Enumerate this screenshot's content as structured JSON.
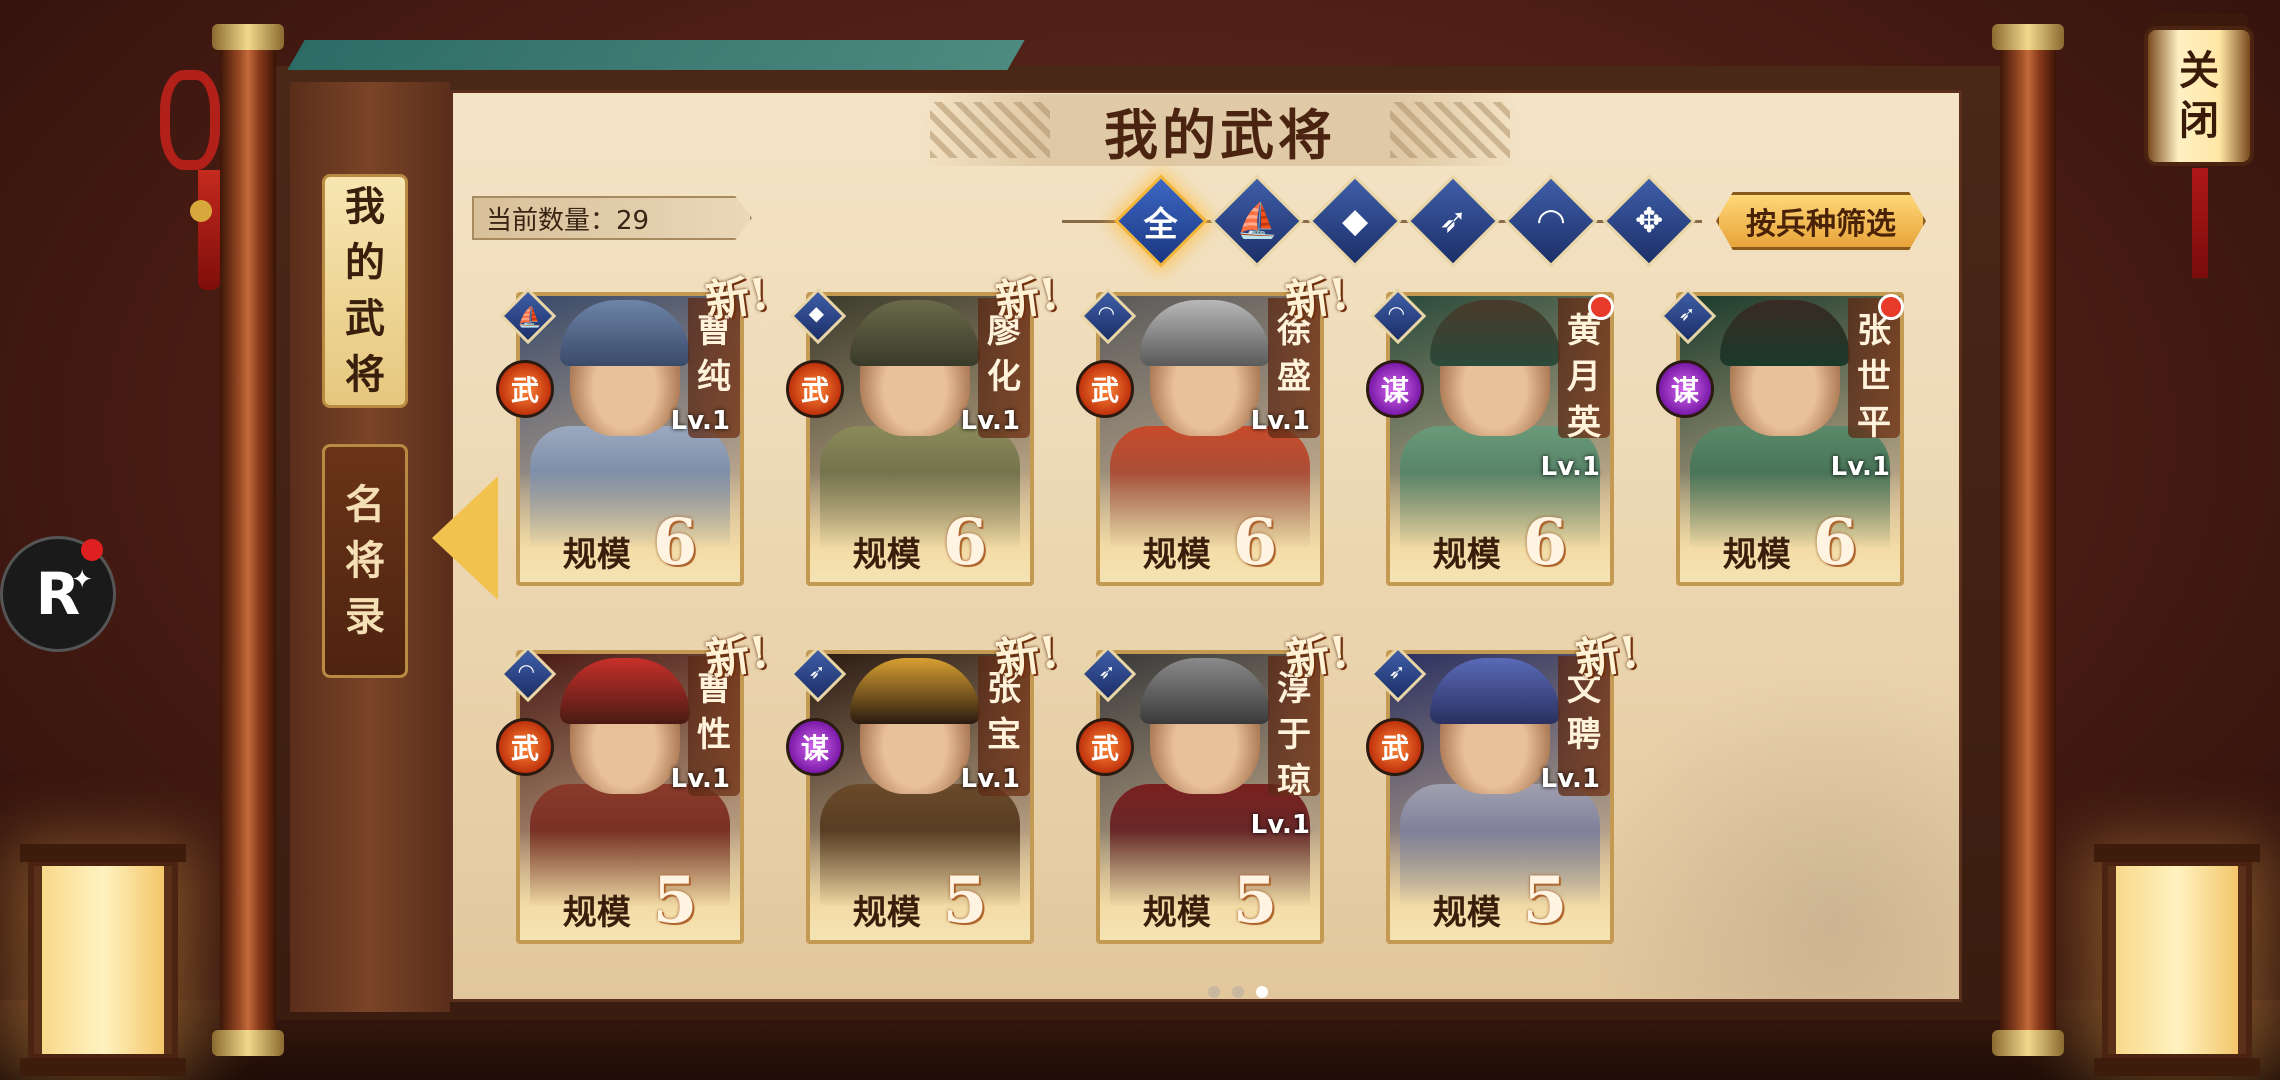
{
  "close_lantern": {
    "label": "关闭"
  },
  "side_tabs": [
    {
      "label": "我的武将",
      "active": true
    },
    {
      "label": "名将录",
      "active": false
    }
  ],
  "title": "我的武将",
  "count": {
    "text": "当前数量：29"
  },
  "filters": [
    {
      "icon": "全",
      "name": "all",
      "active": true
    },
    {
      "icon": "⛵",
      "name": "cavalry"
    },
    {
      "icon": "◆",
      "name": "shield"
    },
    {
      "icon": "➶",
      "name": "spear"
    },
    {
      "icon": "◠",
      "name": "archer"
    },
    {
      "icon": "✥",
      "name": "siege"
    }
  ],
  "filter_button": "按兵种筛选",
  "scale_label": "规模",
  "generals": [
    {
      "name": "曹纯",
      "lv": "Lv.1",
      "class": "武",
      "type_icon": "⛵",
      "scale": "6",
      "new": "新!",
      "notify": false,
      "palette": [
        "#6d84a8",
        "#9aa9c0",
        "#3a4a6a"
      ]
    },
    {
      "name": "廖化",
      "lv": "Lv.1",
      "class": "武",
      "type_icon": "◆",
      "scale": "6",
      "new": "新!",
      "notify": false,
      "palette": [
        "#6a6a4a",
        "#8a8a5a",
        "#3a3a2a"
      ]
    },
    {
      "name": "徐盛",
      "lv": "Lv.1",
      "class": "武",
      "type_icon": "◠",
      "scale": "6",
      "new": "新!",
      "notify": false,
      "palette": [
        "#b8b8b8",
        "#c84a2a",
        "#5a5a5a"
      ]
    },
    {
      "name": "黄月英",
      "lv": "Lv.1",
      "class": "谋",
      "type_icon": "◠",
      "scale": "6",
      "new": "",
      "notify": true,
      "palette": [
        "#4a3a2a",
        "#6a9a7a",
        "#2a4a3a"
      ]
    },
    {
      "name": "张世平",
      "lv": "Lv.1",
      "class": "谋",
      "type_icon": "➶",
      "scale": "6",
      "new": "",
      "notify": true,
      "palette": [
        "#3a2a22",
        "#5a8a6a",
        "#1a3a2a"
      ]
    },
    {
      "name": "曹性",
      "lv": "Lv.1",
      "class": "武",
      "type_icon": "◠",
      "scale": "5",
      "new": "新!",
      "notify": false,
      "palette": [
        "#c8302a",
        "#8a3a2a",
        "#4a1a14"
      ]
    },
    {
      "name": "张宝",
      "lv": "Lv.1",
      "class": "谋",
      "type_icon": "➶",
      "scale": "5",
      "new": "新!",
      "notify": false,
      "palette": [
        "#d8a030",
        "#6a4a2a",
        "#2a1a10"
      ]
    },
    {
      "name": "淳于琼",
      "lv": "Lv.1",
      "class": "武",
      "type_icon": "➶",
      "scale": "5",
      "new": "新!",
      "notify": false,
      "palette": [
        "#8a8a8a",
        "#7a2020",
        "#3a3a3a"
      ]
    },
    {
      "name": "文聘",
      "lv": "Lv.1",
      "class": "武",
      "type_icon": "➶",
      "scale": "5",
      "new": "新!",
      "notify": false,
      "palette": [
        "#5a6ab8",
        "#a0a0b0",
        "#2a3060"
      ]
    }
  ],
  "pager": {
    "pages": 3,
    "current": 3
  }
}
